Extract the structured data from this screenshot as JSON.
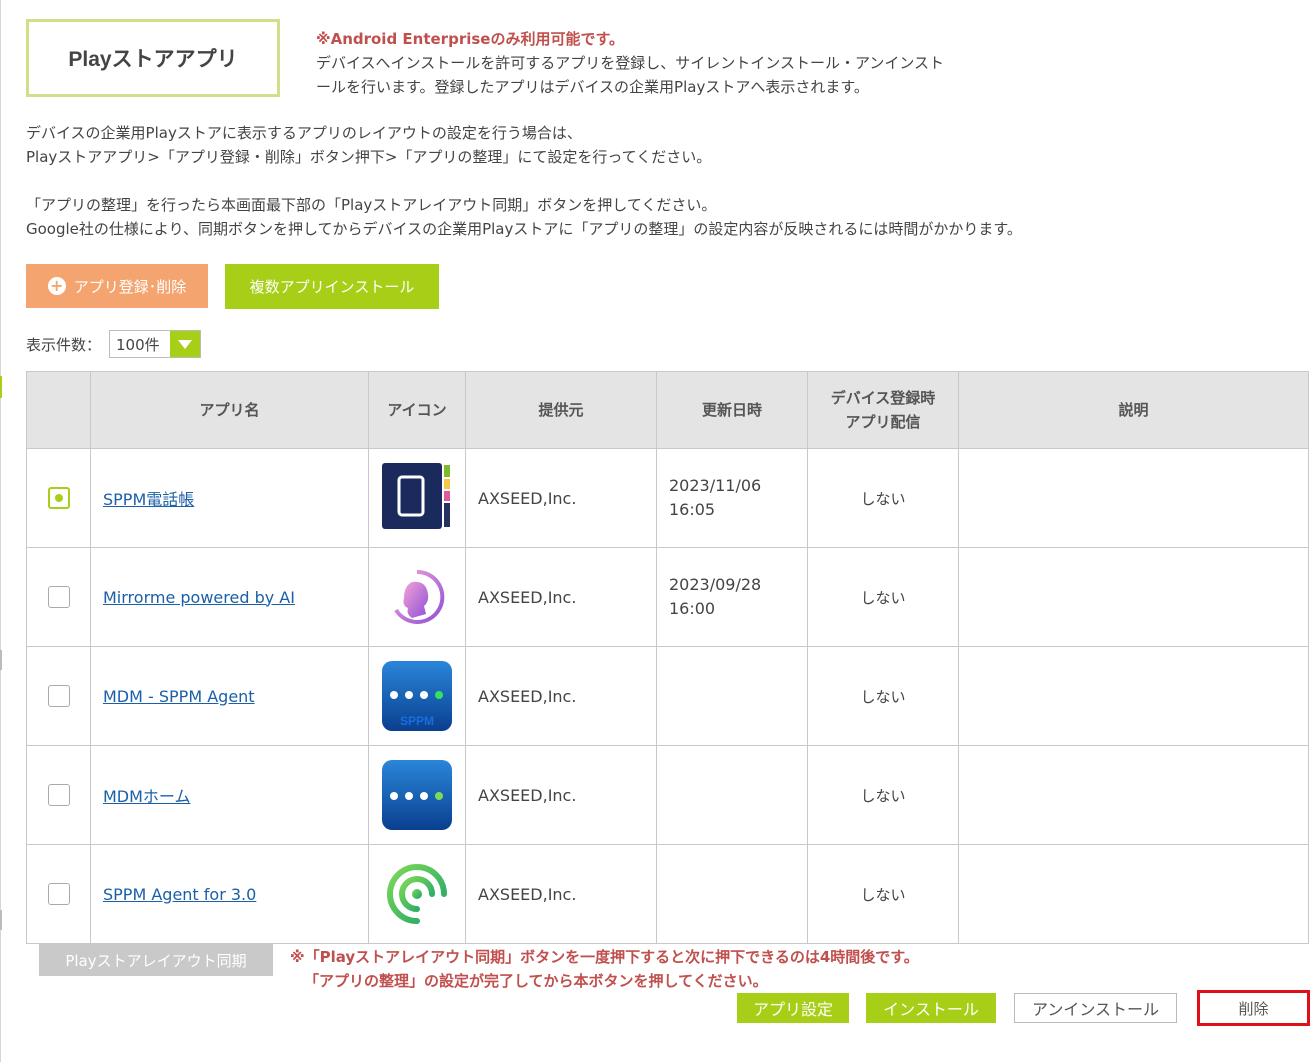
{
  "header": {
    "title": "Playストアアプリ",
    "warning": "※Android Enterpriseのみ利用可能です。",
    "notice_lines": [
      "デバイスへインストールを許可するアプリを登録し、サイレントインストール・アンインスト",
      "ールを行います。登録したアプリはデバイスの企業用Playストアへ表示されます。"
    ]
  },
  "description": {
    "line1": "デバイスの企業用Playストアに表示するアプリのレイアウトの設定を行う場合は、",
    "line2": "Playストアアプリ>「アプリ登録・削除」ボタン押下>「アプリの整理」にて設定を行ってください。",
    "line3": "「アプリの整理」を行ったら本画面最下部の「Playストアレイアウト同期」ボタンを押してください。",
    "line4": "Google社の仕様により、同期ボタンを押してからデバイスの企業用Playストアに「アプリの整理」の設定内容が反映されるには時間がかかります。"
  },
  "actions": {
    "register_delete": "アプリ登録･削除",
    "multi_install": "複数アプリインストール"
  },
  "pager": {
    "label": "表示件数：",
    "selected": "100件"
  },
  "table": {
    "headers": {
      "app_name": "アプリ名",
      "icon": "アイコン",
      "vendor": "提供元",
      "updated": "更新日時",
      "dist_line1": "デバイス登録時",
      "dist_line2": "アプリ配信",
      "description": "説明"
    },
    "rows": [
      {
        "selected": true,
        "name": "SPPM電話帳",
        "icon": "phonebook-icon",
        "vendor": "AXSEED,Inc.",
        "date": "2023/11/06",
        "time": "16:05",
        "dist": "しない",
        "desc": ""
      },
      {
        "selected": false,
        "name": "Mirrorme powered by AI",
        "icon": "mirrorme-icon",
        "vendor": "AXSEED,Inc.",
        "date": "2023/09/28",
        "time": "16:00",
        "dist": "しない",
        "desc": ""
      },
      {
        "selected": false,
        "name": "MDM - SPPM Agent",
        "icon": "sppm-agent-icon",
        "icon_text": "SPPM",
        "vendor": "AXSEED,Inc.",
        "date": "",
        "time": "",
        "dist": "しない",
        "desc": ""
      },
      {
        "selected": false,
        "name": "MDMホーム",
        "icon": "mdm-home-icon",
        "vendor": "AXSEED,Inc.",
        "date": "",
        "time": "",
        "dist": "しない",
        "desc": ""
      },
      {
        "selected": false,
        "name": "SPPM Agent for 3.0",
        "icon": "sppm-agent3-icon",
        "vendor": "AXSEED,Inc.",
        "date": "",
        "time": "",
        "dist": "しない",
        "desc": ""
      }
    ]
  },
  "footer": {
    "sync_button": "Playストアレイアウト同期",
    "sync_note_line1": "※「Playストアレイアウト同期」ボタンを一度押下すると次に押下できるのは4時間後です。",
    "sync_note_line2": "「アプリの整理」の設定が完了してから本ボタンを押してください。",
    "app_settings": "アプリ設定",
    "install": "インストール",
    "uninstall": "アンインストール",
    "delete": "削除"
  },
  "colors": {
    "accent_green": "#a8cf17",
    "accent_orange": "#f4a46e",
    "warning_red": "#c0504d",
    "highlight_red": "#e0101a"
  }
}
